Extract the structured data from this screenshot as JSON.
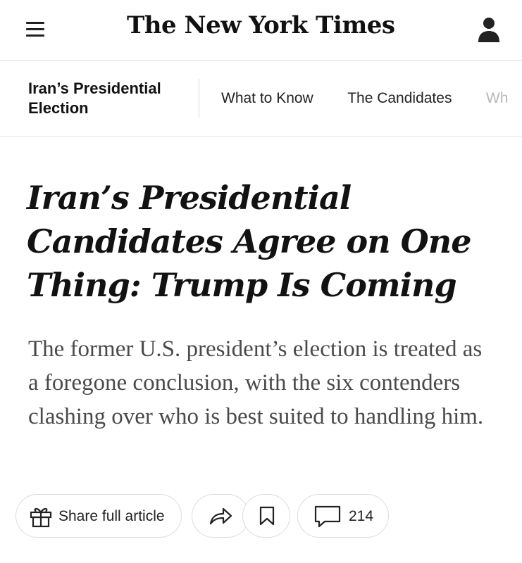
{
  "header": {
    "logo_text": "The New York Times",
    "menu_icon": "hamburger-menu-icon",
    "account_icon": "user-account-icon"
  },
  "section": {
    "title": "Iran’s Presidential Election",
    "nav": [
      {
        "label": "What to Know"
      },
      {
        "label": "The Candidates"
      },
      {
        "label": "Wh"
      }
    ]
  },
  "article": {
    "headline": "Iran’s Presidential Candidates Agree on One Thing: Trump Is Coming",
    "summary": "The former U.S. president’s election is treated as a foregone conclusion, with the six contenders clashing over who is best suited to handling him."
  },
  "actions": {
    "share_full_label": "Share full article",
    "share_icon": "gift-icon",
    "forward_icon": "share-arrow-icon",
    "bookmark_icon": "bookmark-icon",
    "comments_icon": "comment-icon",
    "comments_count": "214"
  },
  "colors": {
    "text_primary": "#121212",
    "text_summary": "#4a4a4a",
    "border": "#dcdcdc",
    "nav_faded": "#b8b8b8"
  }
}
